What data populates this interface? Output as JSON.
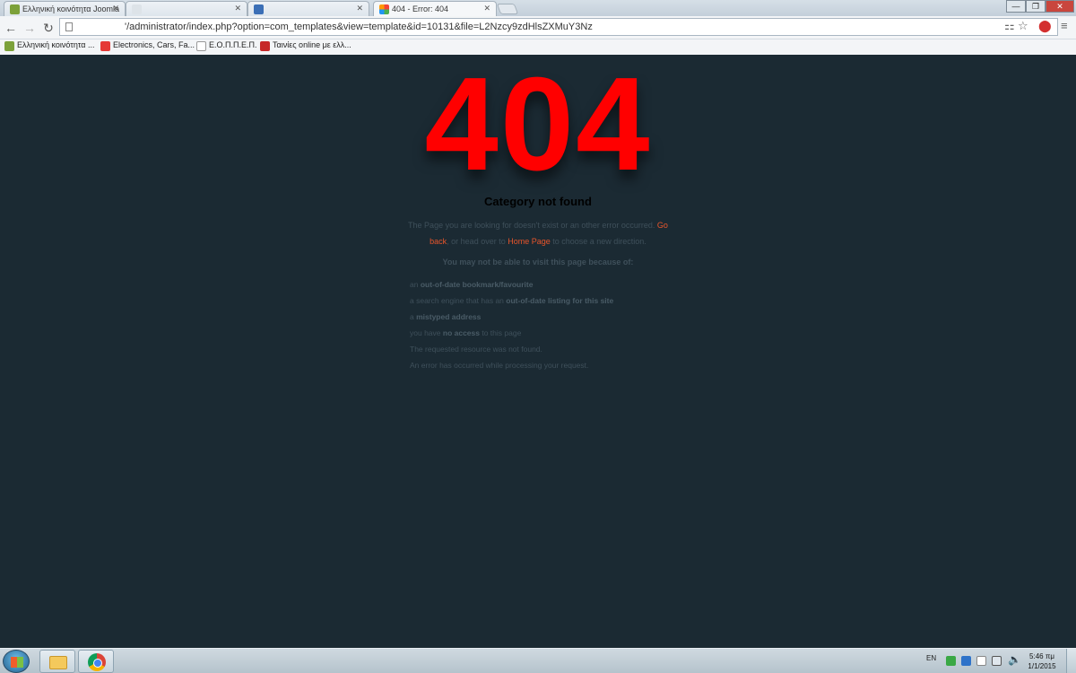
{
  "browser": {
    "tabs": [
      {
        "label": "Ελληνική κοινότητα Joomla",
        "active": false
      },
      {
        "label": "",
        "active": false
      },
      {
        "label": "",
        "active": false
      },
      {
        "label": "404 - Error: 404",
        "active": true
      }
    ],
    "address": "'/administrator/index.php?option=com_templates&view=template&id=10131&file=L2Nzcy9zdHlsZXMuY3Nz",
    "bookmarks": [
      {
        "label": "Ελληνική κοινότητα ..."
      },
      {
        "label": "Electronics, Cars, Fa..."
      },
      {
        "label": "Ε.Ο.Π.Π.Ε.Π."
      },
      {
        "label": "Ταινίες online με ελλ..."
      }
    ]
  },
  "page": {
    "code": "404",
    "title": "Category not found",
    "message_pre": "The Page you are looking for doesn't exist or an other error occurred. ",
    "go_back": "Go back",
    "message_mid": ", or head over to ",
    "home_page": "Home Page",
    "message_post": " to choose a new direction.",
    "reasons_heading": "You may not be able to visit this page because of:",
    "reasons": [
      {
        "pre": "an ",
        "bold": "out-of-date bookmark/favourite",
        "post": ""
      },
      {
        "pre": "a search engine that has an ",
        "bold": "out-of-date listing for this site",
        "post": ""
      },
      {
        "pre": "a ",
        "bold": "mistyped address",
        "post": ""
      },
      {
        "pre": "you have ",
        "bold": "no access",
        "post": " to this page"
      },
      {
        "pre": "The requested resource was not found.",
        "bold": "",
        "post": ""
      },
      {
        "pre": "An error has occurred while processing your request.",
        "bold": "",
        "post": ""
      }
    ],
    "colors": {
      "code": "#ff0000",
      "background": "#1b2a33",
      "link": "#e8552b"
    }
  },
  "taskbar": {
    "language": "EN",
    "time": "5:46 πμ",
    "date": "1/1/2015",
    "icons": [
      "windows-start-icon",
      "file-explorer-icon",
      "chrome-icon"
    ]
  }
}
